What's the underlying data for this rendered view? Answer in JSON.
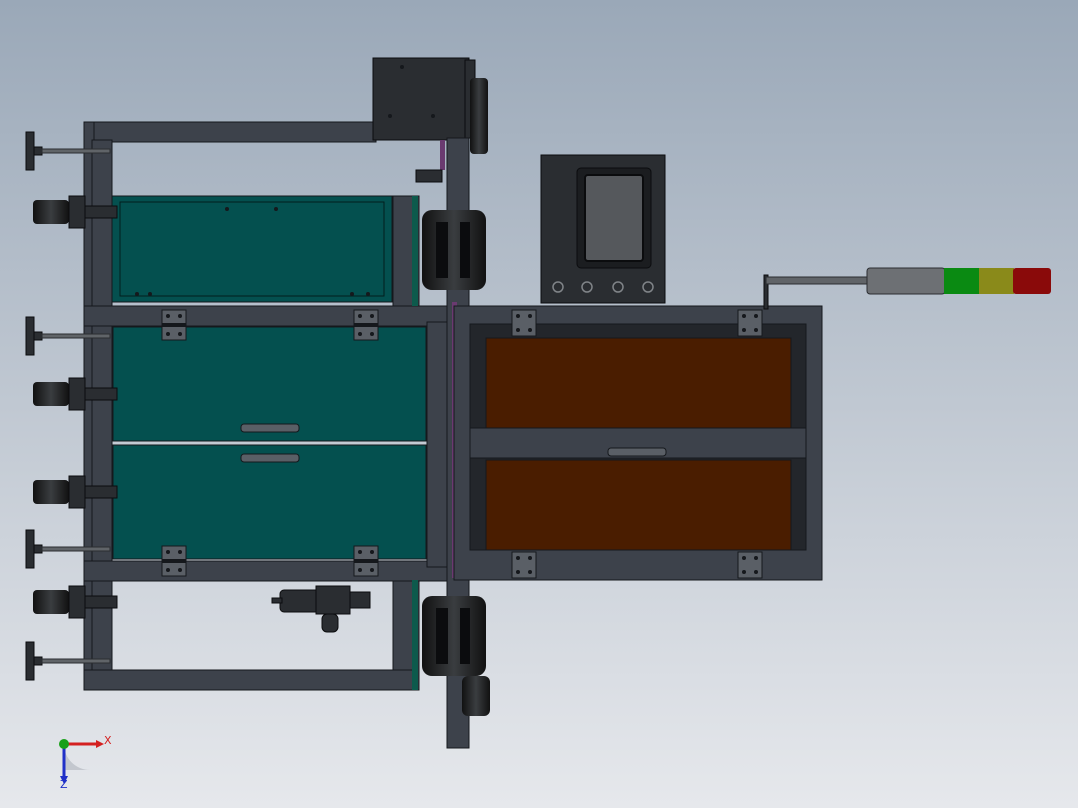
{
  "viewport": {
    "background_top": "#9aa8b8",
    "background_bottom": "#e6e8ec"
  },
  "colors": {
    "frame": "#3d424b",
    "frame_edge": "#15181c",
    "teal_panel": "#04504f",
    "brown_panel": "#4a1d00",
    "purple_strip": "#6a3a70",
    "dark_part": "#2a2d31",
    "screen": "#55585c",
    "rod": "#606468",
    "light_green": "#0a8a12",
    "light_yellow": "#8a8a1a",
    "light_red": "#8a0a0a",
    "light_grey": "#6d7074",
    "axis_x": "#d42020",
    "axis_y": "#18a018",
    "axis_z": "#2030c8"
  },
  "triad": {
    "x_label": "X",
    "z_label": "Z"
  },
  "stack_light": {
    "segments": [
      "grey",
      "green",
      "yellow",
      "red"
    ]
  },
  "icons": [
    "coordinate-triad-icon"
  ]
}
